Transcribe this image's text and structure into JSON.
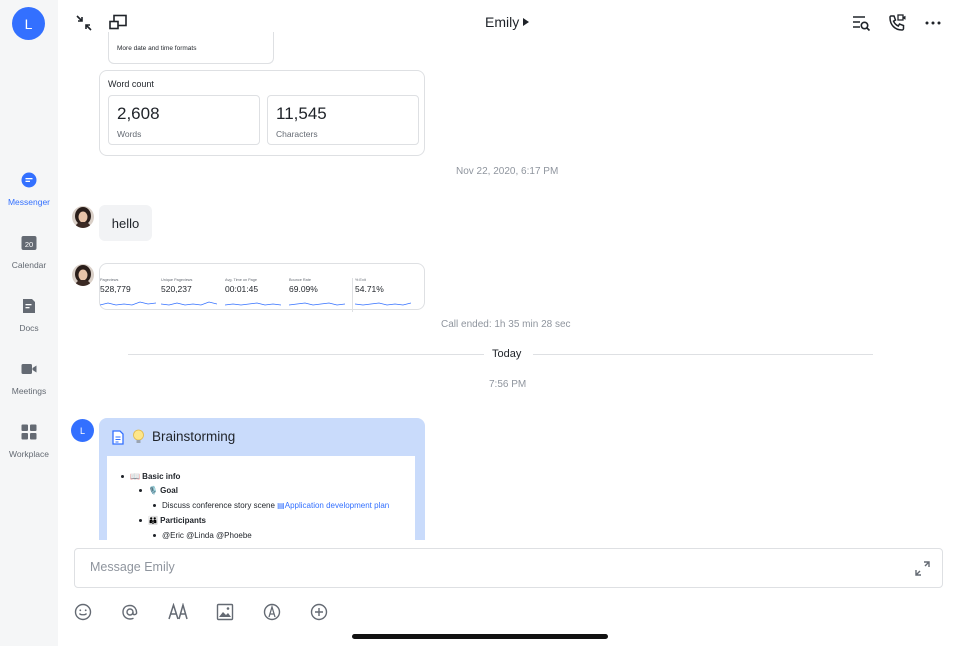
{
  "user": {
    "avatar_initial": "L"
  },
  "sidebar": {
    "items": [
      {
        "label": "Messenger",
        "icon": "chat-bubble-icon",
        "active": true
      },
      {
        "label": "Calendar",
        "icon": "calendar-icon",
        "badge": "20"
      },
      {
        "label": "Docs",
        "icon": "docs-icon"
      },
      {
        "label": "Meetings",
        "icon": "video-camera-icon"
      },
      {
        "label": "Workplace",
        "icon": "grid-icon"
      }
    ]
  },
  "header": {
    "title": "Emily"
  },
  "messages": {
    "date_card_partial": "More date and time formats",
    "word_count": {
      "title": "Word count",
      "words_value": "2,608",
      "words_label": "Words",
      "chars_value": "11,545",
      "chars_label": "Characters"
    },
    "timestamp1": "Nov 22, 2020, 6:17 PM",
    "hello": "hello",
    "metrics": [
      {
        "label": "Pageviews",
        "value": "528,779"
      },
      {
        "label": "Unique Pageviews",
        "value": "520,237"
      },
      {
        "label": "Avg. Time on Page",
        "value": "00:01:45"
      },
      {
        "label": "Bounce Rate",
        "value": "69.09%"
      },
      {
        "label": "% Exit",
        "value": "54.71%"
      }
    ],
    "call_ended": "Call ended: 1h 35 min 28 sec",
    "divider": "Today",
    "timestamp2": "7:56 PM",
    "brainstorm": {
      "title": "Brainstorming",
      "basic_info": "📖 Basic info",
      "goal": "🎙️ Goal",
      "goal_text": "Discuss conference story scene",
      "goal_link": "Application development plan",
      "participants": "👪 Participants",
      "participants_text": "@Eric @Linda @Phoebe"
    }
  },
  "input": {
    "placeholder": "Message Emily"
  },
  "colors": {
    "accent": "#3370ff",
    "sidebar_bg": "#f5f6f7",
    "doc_header": "#c9dbfb"
  }
}
